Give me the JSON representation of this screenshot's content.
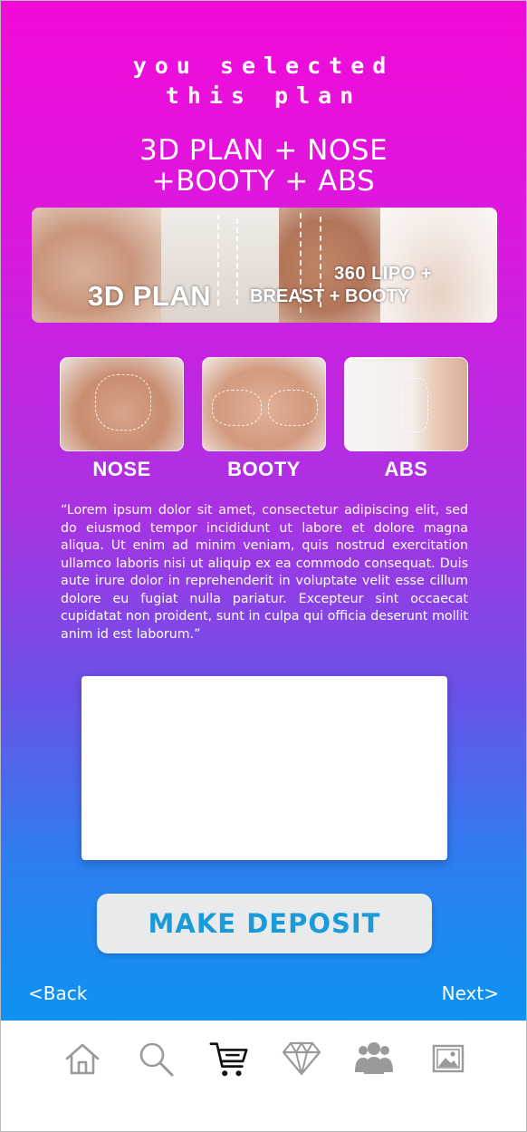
{
  "header": {
    "line1": "YOU SELECTED",
    "line2": "THIS PLAN"
  },
  "plan": {
    "title_line1": "3D PLAN + NOSE",
    "title_line2": "+BOOTY + ABS"
  },
  "hero_banner": {
    "main_text": "3D PLAN",
    "sub_text_1": "360 LIPO +",
    "sub_text_2": "BREAST + BOOTY"
  },
  "addons": [
    {
      "label": "NOSE"
    },
    {
      "label": "BOOTY"
    },
    {
      "label": "ABS"
    }
  ],
  "description": "“Lorem ipsum dolor sit amet, consectetur adipiscing elit, sed do eiusmod tempor incididunt ut labore et dolore magna aliqua. Ut enim ad minim veniam, quis nostrud exercitation ullamco laboris nisi ut aliquip ex ea commodo consequat. Duis aute irure dolor in reprehenderit in voluptate velit esse cillum dolore eu fugiat nulla pariatur. Excepteur sint occaecat cupidatat non proident, sunt in culpa qui officia deserunt mollit anim id est laborum.”",
  "actions": {
    "deposit_label": "MAKE DEPOSIT",
    "back_label": "<Back",
    "next_label": "Next>"
  },
  "tabbar": {
    "items": [
      {
        "icon": "home-icon",
        "active": false
      },
      {
        "icon": "search-icon",
        "active": false
      },
      {
        "icon": "cart-icon",
        "active": true
      },
      {
        "icon": "diamond-icon",
        "active": false
      },
      {
        "icon": "group-icon",
        "active": false
      },
      {
        "icon": "image-icon",
        "active": false
      }
    ]
  },
  "colors": {
    "gradient_top": "#f20ad8",
    "gradient_bottom": "#0d92f2",
    "deposit_text": "#1b9ad9",
    "icon_inactive": "#9a9a9a",
    "icon_active": "#111111"
  }
}
